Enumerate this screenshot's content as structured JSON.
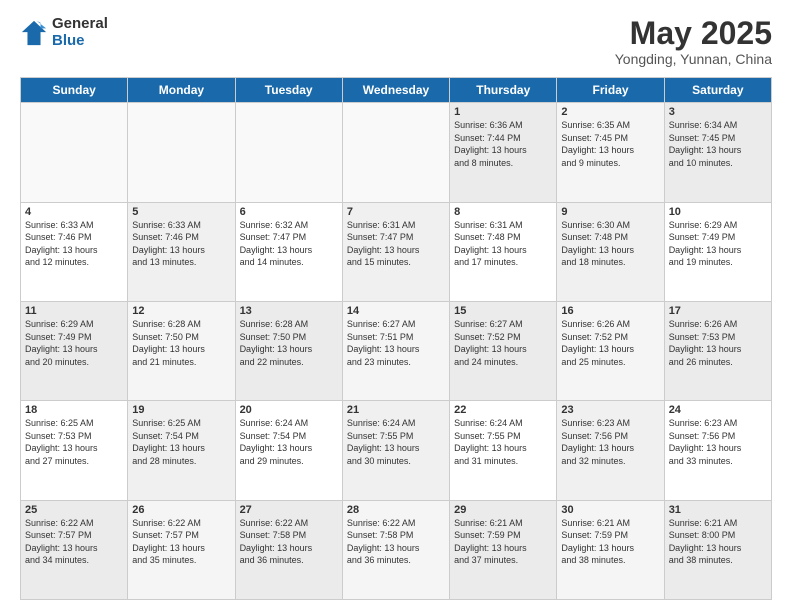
{
  "header": {
    "logo_general": "General",
    "logo_blue": "Blue",
    "title": "May 2025",
    "subtitle": "Yongding, Yunnan, China"
  },
  "weekdays": [
    "Sunday",
    "Monday",
    "Tuesday",
    "Wednesday",
    "Thursday",
    "Friday",
    "Saturday"
  ],
  "weeks": [
    [
      {
        "day": "",
        "info": ""
      },
      {
        "day": "",
        "info": ""
      },
      {
        "day": "",
        "info": ""
      },
      {
        "day": "",
        "info": ""
      },
      {
        "day": "1",
        "info": "Sunrise: 6:36 AM\nSunset: 7:44 PM\nDaylight: 13 hours\nand 8 minutes."
      },
      {
        "day": "2",
        "info": "Sunrise: 6:35 AM\nSunset: 7:45 PM\nDaylight: 13 hours\nand 9 minutes."
      },
      {
        "day": "3",
        "info": "Sunrise: 6:34 AM\nSunset: 7:45 PM\nDaylight: 13 hours\nand 10 minutes."
      }
    ],
    [
      {
        "day": "4",
        "info": "Sunrise: 6:33 AM\nSunset: 7:46 PM\nDaylight: 13 hours\nand 12 minutes."
      },
      {
        "day": "5",
        "info": "Sunrise: 6:33 AM\nSunset: 7:46 PM\nDaylight: 13 hours\nand 13 minutes."
      },
      {
        "day": "6",
        "info": "Sunrise: 6:32 AM\nSunset: 7:47 PM\nDaylight: 13 hours\nand 14 minutes."
      },
      {
        "day": "7",
        "info": "Sunrise: 6:31 AM\nSunset: 7:47 PM\nDaylight: 13 hours\nand 15 minutes."
      },
      {
        "day": "8",
        "info": "Sunrise: 6:31 AM\nSunset: 7:48 PM\nDaylight: 13 hours\nand 17 minutes."
      },
      {
        "day": "9",
        "info": "Sunrise: 6:30 AM\nSunset: 7:48 PM\nDaylight: 13 hours\nand 18 minutes."
      },
      {
        "day": "10",
        "info": "Sunrise: 6:29 AM\nSunset: 7:49 PM\nDaylight: 13 hours\nand 19 minutes."
      }
    ],
    [
      {
        "day": "11",
        "info": "Sunrise: 6:29 AM\nSunset: 7:49 PM\nDaylight: 13 hours\nand 20 minutes."
      },
      {
        "day": "12",
        "info": "Sunrise: 6:28 AM\nSunset: 7:50 PM\nDaylight: 13 hours\nand 21 minutes."
      },
      {
        "day": "13",
        "info": "Sunrise: 6:28 AM\nSunset: 7:50 PM\nDaylight: 13 hours\nand 22 minutes."
      },
      {
        "day": "14",
        "info": "Sunrise: 6:27 AM\nSunset: 7:51 PM\nDaylight: 13 hours\nand 23 minutes."
      },
      {
        "day": "15",
        "info": "Sunrise: 6:27 AM\nSunset: 7:52 PM\nDaylight: 13 hours\nand 24 minutes."
      },
      {
        "day": "16",
        "info": "Sunrise: 6:26 AM\nSunset: 7:52 PM\nDaylight: 13 hours\nand 25 minutes."
      },
      {
        "day": "17",
        "info": "Sunrise: 6:26 AM\nSunset: 7:53 PM\nDaylight: 13 hours\nand 26 minutes."
      }
    ],
    [
      {
        "day": "18",
        "info": "Sunrise: 6:25 AM\nSunset: 7:53 PM\nDaylight: 13 hours\nand 27 minutes."
      },
      {
        "day": "19",
        "info": "Sunrise: 6:25 AM\nSunset: 7:54 PM\nDaylight: 13 hours\nand 28 minutes."
      },
      {
        "day": "20",
        "info": "Sunrise: 6:24 AM\nSunset: 7:54 PM\nDaylight: 13 hours\nand 29 minutes."
      },
      {
        "day": "21",
        "info": "Sunrise: 6:24 AM\nSunset: 7:55 PM\nDaylight: 13 hours\nand 30 minutes."
      },
      {
        "day": "22",
        "info": "Sunrise: 6:24 AM\nSunset: 7:55 PM\nDaylight: 13 hours\nand 31 minutes."
      },
      {
        "day": "23",
        "info": "Sunrise: 6:23 AM\nSunset: 7:56 PM\nDaylight: 13 hours\nand 32 minutes."
      },
      {
        "day": "24",
        "info": "Sunrise: 6:23 AM\nSunset: 7:56 PM\nDaylight: 13 hours\nand 33 minutes."
      }
    ],
    [
      {
        "day": "25",
        "info": "Sunrise: 6:22 AM\nSunset: 7:57 PM\nDaylight: 13 hours\nand 34 minutes."
      },
      {
        "day": "26",
        "info": "Sunrise: 6:22 AM\nSunset: 7:57 PM\nDaylight: 13 hours\nand 35 minutes."
      },
      {
        "day": "27",
        "info": "Sunrise: 6:22 AM\nSunset: 7:58 PM\nDaylight: 13 hours\nand 36 minutes."
      },
      {
        "day": "28",
        "info": "Sunrise: 6:22 AM\nSunset: 7:58 PM\nDaylight: 13 hours\nand 36 minutes."
      },
      {
        "day": "29",
        "info": "Sunrise: 6:21 AM\nSunset: 7:59 PM\nDaylight: 13 hours\nand 37 minutes."
      },
      {
        "day": "30",
        "info": "Sunrise: 6:21 AM\nSunset: 7:59 PM\nDaylight: 13 hours\nand 38 minutes."
      },
      {
        "day": "31",
        "info": "Sunrise: 6:21 AM\nSunset: 8:00 PM\nDaylight: 13 hours\nand 38 minutes."
      }
    ]
  ]
}
